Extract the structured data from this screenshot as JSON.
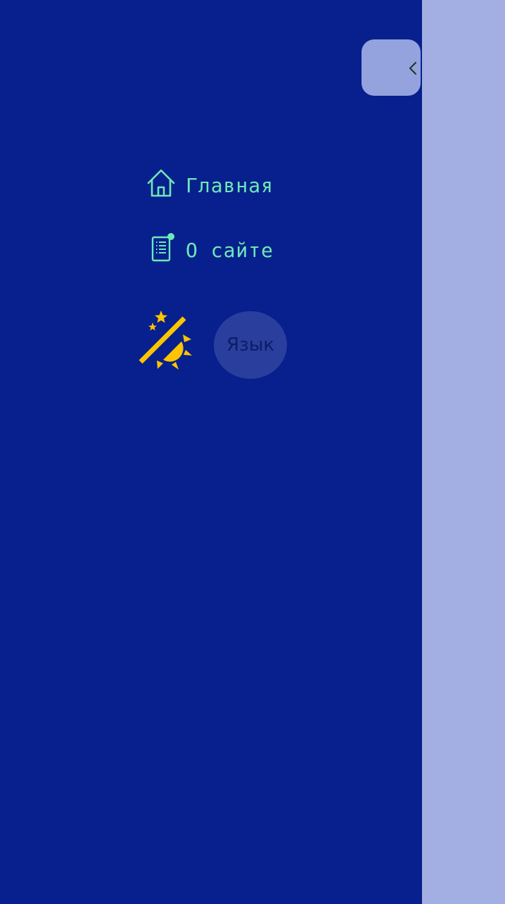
{
  "drawer": {
    "close_icon": "chevron-left-icon",
    "nav": [
      {
        "label": "Главная",
        "icon": "home-icon"
      },
      {
        "label": "О сайте",
        "icon": "document-icon"
      }
    ],
    "theme_toggle_icon": "moon-sun-icon",
    "language_label": "Язык"
  },
  "colors": {
    "drawer_bg": "#07208d",
    "backdrop": "#a3aee3",
    "nav_text": "#6ee7b7",
    "theme_icon": "#ffc400",
    "language_bg": "#2a3e9e"
  }
}
